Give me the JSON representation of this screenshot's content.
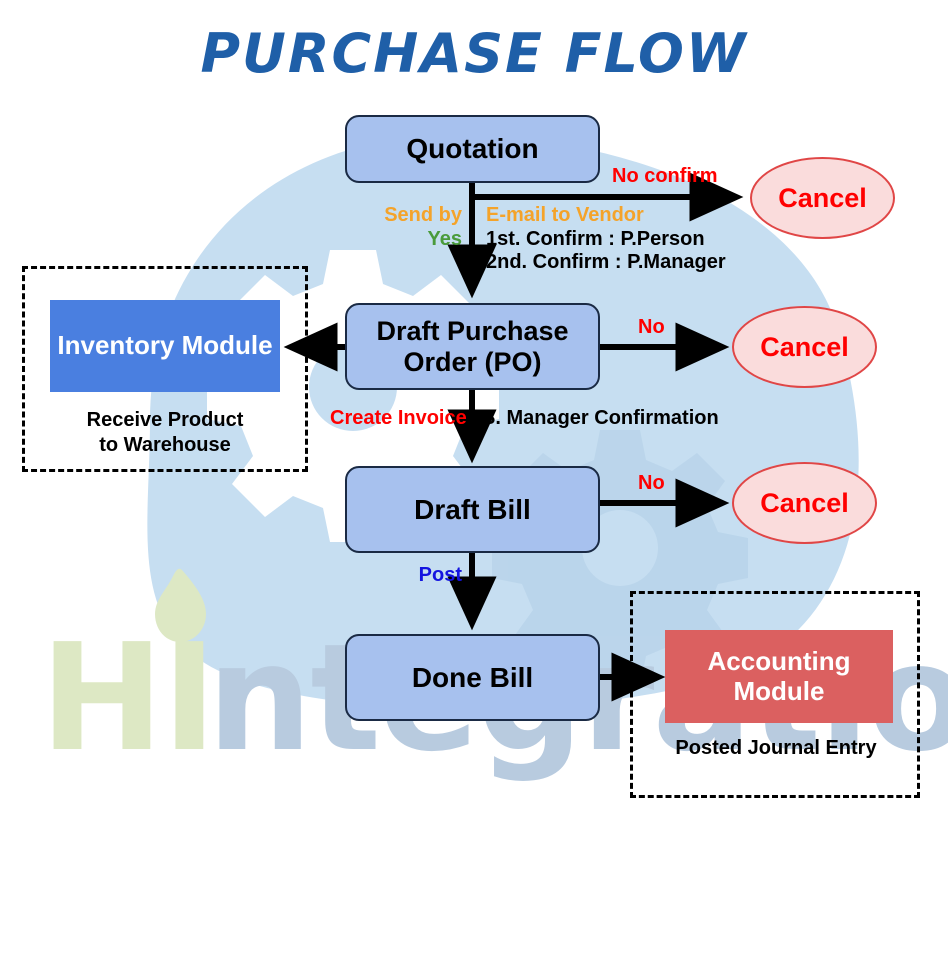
{
  "title": "PURCHASE FLOW",
  "watermark": {
    "part1": "HI",
    "part2": "ntegration",
    "color1": "#dde8c4",
    "color2": "#b8cbdf"
  },
  "colors": {
    "node_fill": "#a7c1ee",
    "node_border": "#1a2a44",
    "cancel_fill": "#fadcdc",
    "cancel_border": "#e04646",
    "cancel_text": "#ff0000",
    "inventory_fill": "#4a7fe0",
    "accounting_fill": "#db6060",
    "title_color": "#1f5fa8",
    "cloud": "#c6def1",
    "orange": "#f4a32a",
    "green": "#4a9b3c",
    "red": "#ff0000",
    "blue": "#1414e0",
    "black": "#000000"
  },
  "nodes": {
    "quotation": "Quotation",
    "draft_po_line1": "Draft Purchase",
    "draft_po_line2": "Order (PO)",
    "draft_bill": "Draft Bill",
    "done_bill": "Done Bill"
  },
  "cancels": {
    "top": "Cancel",
    "middle": "Cancel",
    "bottom": "Cancel"
  },
  "modules": {
    "inventory": {
      "label": "Inventory Module",
      "caption_line1": "Receive Product",
      "caption_line2": "to  Warehouse"
    },
    "accounting": {
      "label_line1": "Accounting",
      "label_line2": "Module",
      "caption": "Posted Journal Entry"
    }
  },
  "edge_labels": {
    "no_confirm": "No confirm",
    "send_by": "Send by",
    "yes": "Yes",
    "email_to_vendor": "E-mail to Vendor",
    "confirm_1": "1st. Confirm : P.Person",
    "confirm_2": "2nd. Confirm : P.Manager",
    "no_po": "No",
    "create_invoice": "Create Invoice",
    "s_manager_confirmation": "S. Manager Confirmation",
    "no_bill": "No",
    "post": "Post"
  },
  "chart_data": {
    "type": "diagram",
    "title": "PURCHASE FLOW",
    "nodes": [
      {
        "id": "quotation",
        "label": "Quotation",
        "shape": "rounded-rect",
        "fill": "#a7c1ee"
      },
      {
        "id": "draft_po",
        "label": "Draft Purchase Order (PO)",
        "shape": "rounded-rect",
        "fill": "#a7c1ee"
      },
      {
        "id": "draft_bill",
        "label": "Draft Bill",
        "shape": "rounded-rect",
        "fill": "#a7c1ee"
      },
      {
        "id": "done_bill",
        "label": "Done Bill",
        "shape": "rounded-rect",
        "fill": "#a7c1ee"
      },
      {
        "id": "cancel_1",
        "label": "Cancel",
        "shape": "ellipse",
        "fill": "#fadcdc"
      },
      {
        "id": "cancel_2",
        "label": "Cancel",
        "shape": "ellipse",
        "fill": "#fadcdc"
      },
      {
        "id": "cancel_3",
        "label": "Cancel",
        "shape": "ellipse",
        "fill": "#fadcdc"
      },
      {
        "id": "inventory_module",
        "label": "Inventory Module",
        "shape": "rect",
        "fill": "#4a7fe0"
      },
      {
        "id": "accounting_module",
        "label": "Accounting Module",
        "shape": "rect",
        "fill": "#db6060"
      }
    ],
    "edges": [
      {
        "from": "quotation",
        "to": "cancel_1",
        "label": "No confirm"
      },
      {
        "from": "quotation",
        "to": "draft_po",
        "label": "Send by Yes / E-mail to Vendor / 1st. Confirm : P.Person / 2nd. Confirm : P.Manager"
      },
      {
        "from": "draft_po",
        "to": "cancel_2",
        "label": "No"
      },
      {
        "from": "draft_po",
        "to": "inventory_module",
        "label": ""
      },
      {
        "from": "draft_po",
        "to": "draft_bill",
        "label": "Create Invoice / S. Manager Confirmation"
      },
      {
        "from": "draft_bill",
        "to": "cancel_3",
        "label": "No"
      },
      {
        "from": "draft_bill",
        "to": "done_bill",
        "label": "Post"
      },
      {
        "from": "done_bill",
        "to": "accounting_module",
        "label": ""
      }
    ]
  }
}
